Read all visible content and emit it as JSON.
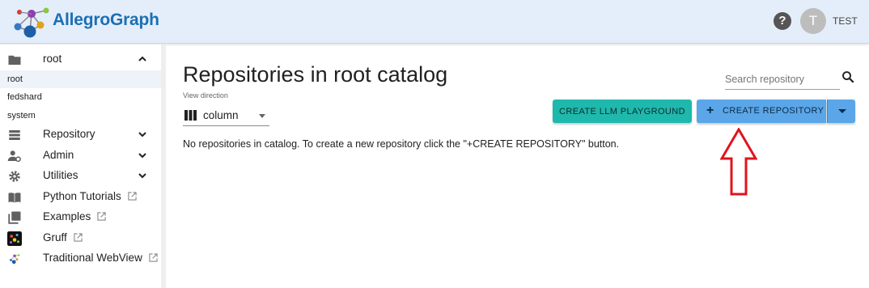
{
  "header": {
    "brand": "AllegroGraph",
    "help_icon": "question-circle-icon",
    "avatar_initial": "T",
    "user_name": "TEST"
  },
  "sidebar": {
    "catalog": {
      "label": "root",
      "icon": "folder-icon",
      "expanded": true
    },
    "catalog_items": [
      {
        "label": "root",
        "active": true
      },
      {
        "label": "fedshard",
        "active": false
      },
      {
        "label": "system",
        "active": false
      }
    ],
    "items": [
      {
        "label": "Repository",
        "icon": "list-icon",
        "has_chevron": true
      },
      {
        "label": "Admin",
        "icon": "admin-users-icon",
        "has_chevron": true
      },
      {
        "label": "Utilities",
        "icon": "gear-icon",
        "has_chevron": true
      },
      {
        "label": "Python Tutorials",
        "icon": "book-icon",
        "external": true
      },
      {
        "label": "Examples",
        "icon": "library-icon",
        "external": true
      },
      {
        "label": "Gruff",
        "icon": "gruff-icon",
        "external": true
      },
      {
        "label": "Traditional WebView",
        "icon": "molecule-icon",
        "external": true
      }
    ]
  },
  "main": {
    "title": "Repositories in root catalog",
    "view_direction_label": "View direction",
    "view_direction_value": "column",
    "search_placeholder": "Search repository",
    "create_llm_label": "CREATE LLM PLAYGROUND",
    "create_repo_label": "CREATE REPOSITORY",
    "create_repo_plus": "+",
    "empty_message": "No repositories in catalog. To create a new repository click the \"+CREATE REPOSITORY\" button."
  },
  "colors": {
    "header_bg": "#e4eefa",
    "brand": "#1b6fb3",
    "llm_button": "#1fb8ad",
    "create_button": "#5aa6e8",
    "annotation_arrow": "#e0141e"
  }
}
